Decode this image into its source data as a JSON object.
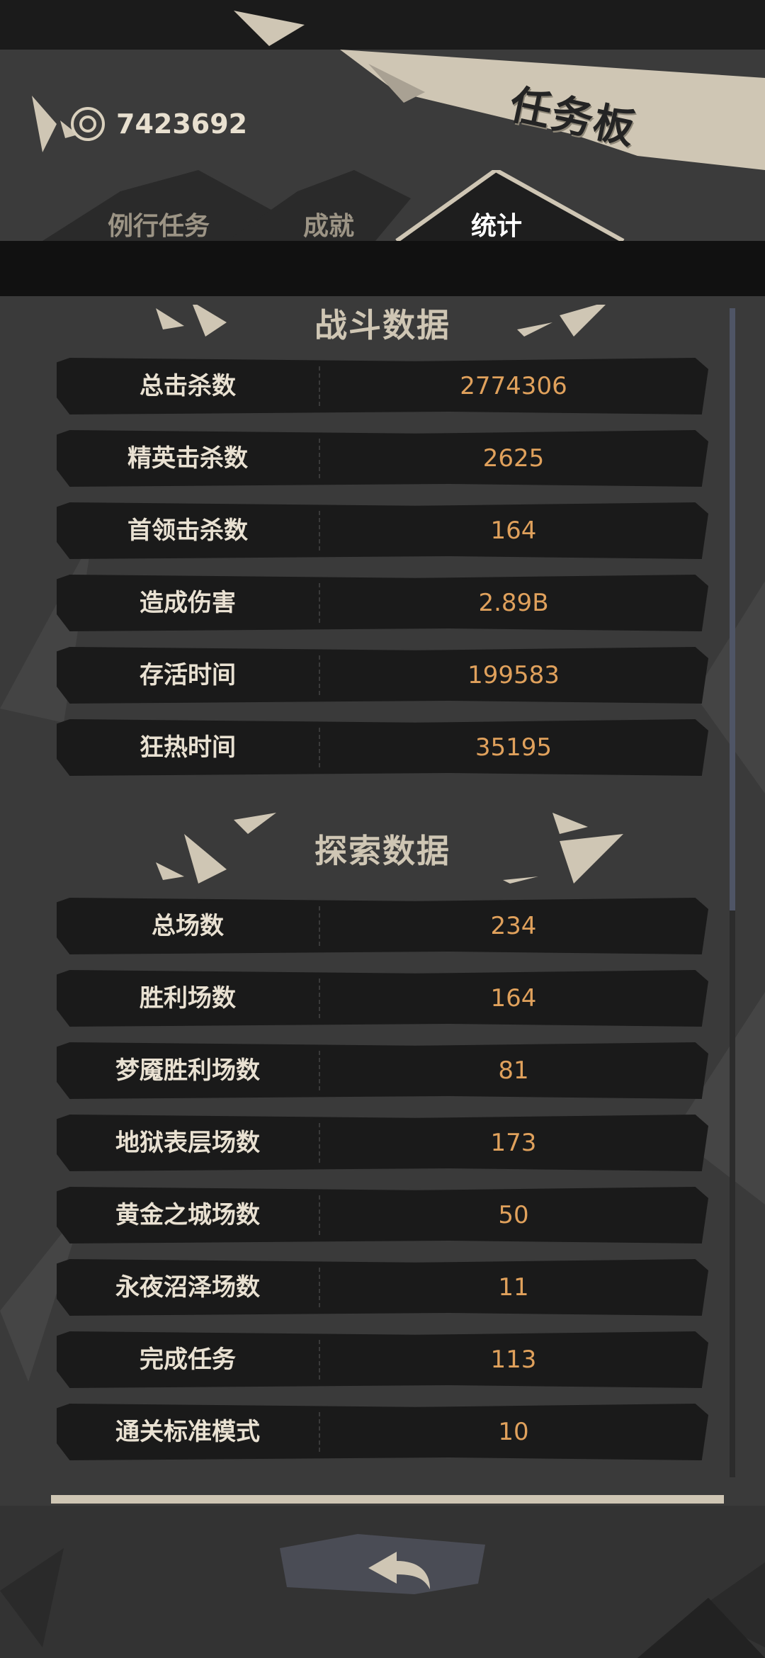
{
  "header": {
    "title": "任务板",
    "coin_icon": "coin-eye-icon",
    "coin_value": "7423692"
  },
  "tabs": [
    {
      "label": "例行任务",
      "active": false
    },
    {
      "label": "成就",
      "active": false
    },
    {
      "label": "统计",
      "active": true
    }
  ],
  "sections": {
    "combat": {
      "title": "战斗数据",
      "rows": [
        {
          "label": "总击杀数",
          "value": "2774306"
        },
        {
          "label": "精英击杀数",
          "value": "2625"
        },
        {
          "label": "首领击杀数",
          "value": "164"
        },
        {
          "label": "造成伤害",
          "value": "2.89B"
        },
        {
          "label": "存活时间",
          "value": "199583"
        },
        {
          "label": "狂热时间",
          "value": "35195"
        }
      ]
    },
    "explore": {
      "title": "探索数据",
      "rows": [
        {
          "label": "总场数",
          "value": "234"
        },
        {
          "label": "胜利场数",
          "value": "164"
        },
        {
          "label": "梦魇胜利场数",
          "value": "81"
        },
        {
          "label": "地狱表层场数",
          "value": "173"
        },
        {
          "label": "黄金之城场数",
          "value": "50"
        },
        {
          "label": "永夜沼泽场数",
          "value": "11"
        },
        {
          "label": "完成任务",
          "value": "113"
        },
        {
          "label": "通关标准模式",
          "value": "10"
        }
      ]
    }
  },
  "footer": {
    "back_icon": "back-arrow-icon"
  },
  "colors": {
    "accent_value": "#e0a15c",
    "label": "#e9e1d2",
    "title_parchment": "#cfc6b4",
    "row_bg": "#1a1a1a"
  }
}
